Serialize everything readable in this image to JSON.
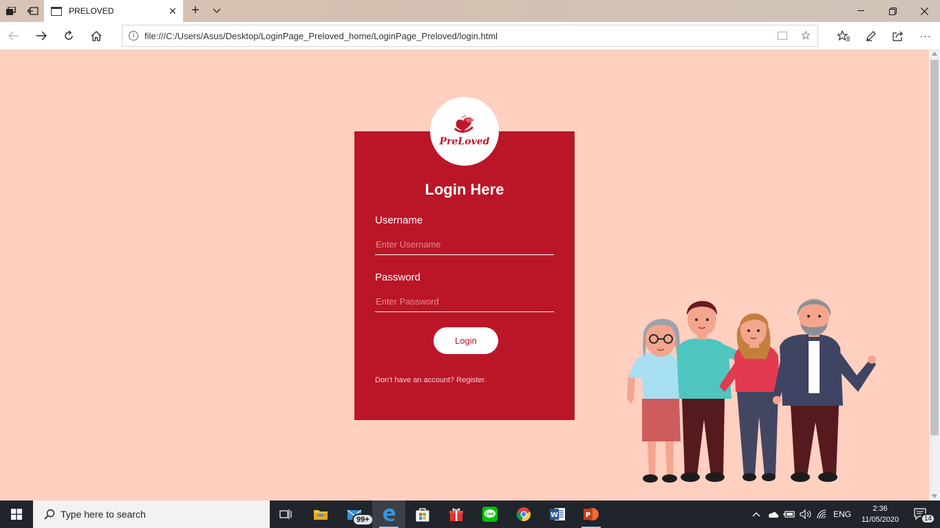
{
  "browser": {
    "tab_title": "PRELOVED",
    "url": "file:///C:/Users/Asus/Desktop/LoginPage_Preloved_home/LoginPage_Preloved/login.html"
  },
  "login": {
    "logo_text": "PreLoved",
    "title": "Login Here",
    "username_label": "Username",
    "username_placeholder": "Enter Username",
    "password_label": "Password",
    "password_placeholder": "Enter Password",
    "login_button": "Login",
    "register_text": "Don't have an account? Register."
  },
  "taskbar": {
    "search_placeholder": "Type here to search",
    "mail_badge": "99+",
    "language": "ENG",
    "time": "2:36",
    "date": "11/05/2020",
    "notification_count": "14"
  },
  "colors": {
    "page_background": "#ffcfc0",
    "card_background": "#bb1628",
    "taskbar": "#20252b"
  }
}
